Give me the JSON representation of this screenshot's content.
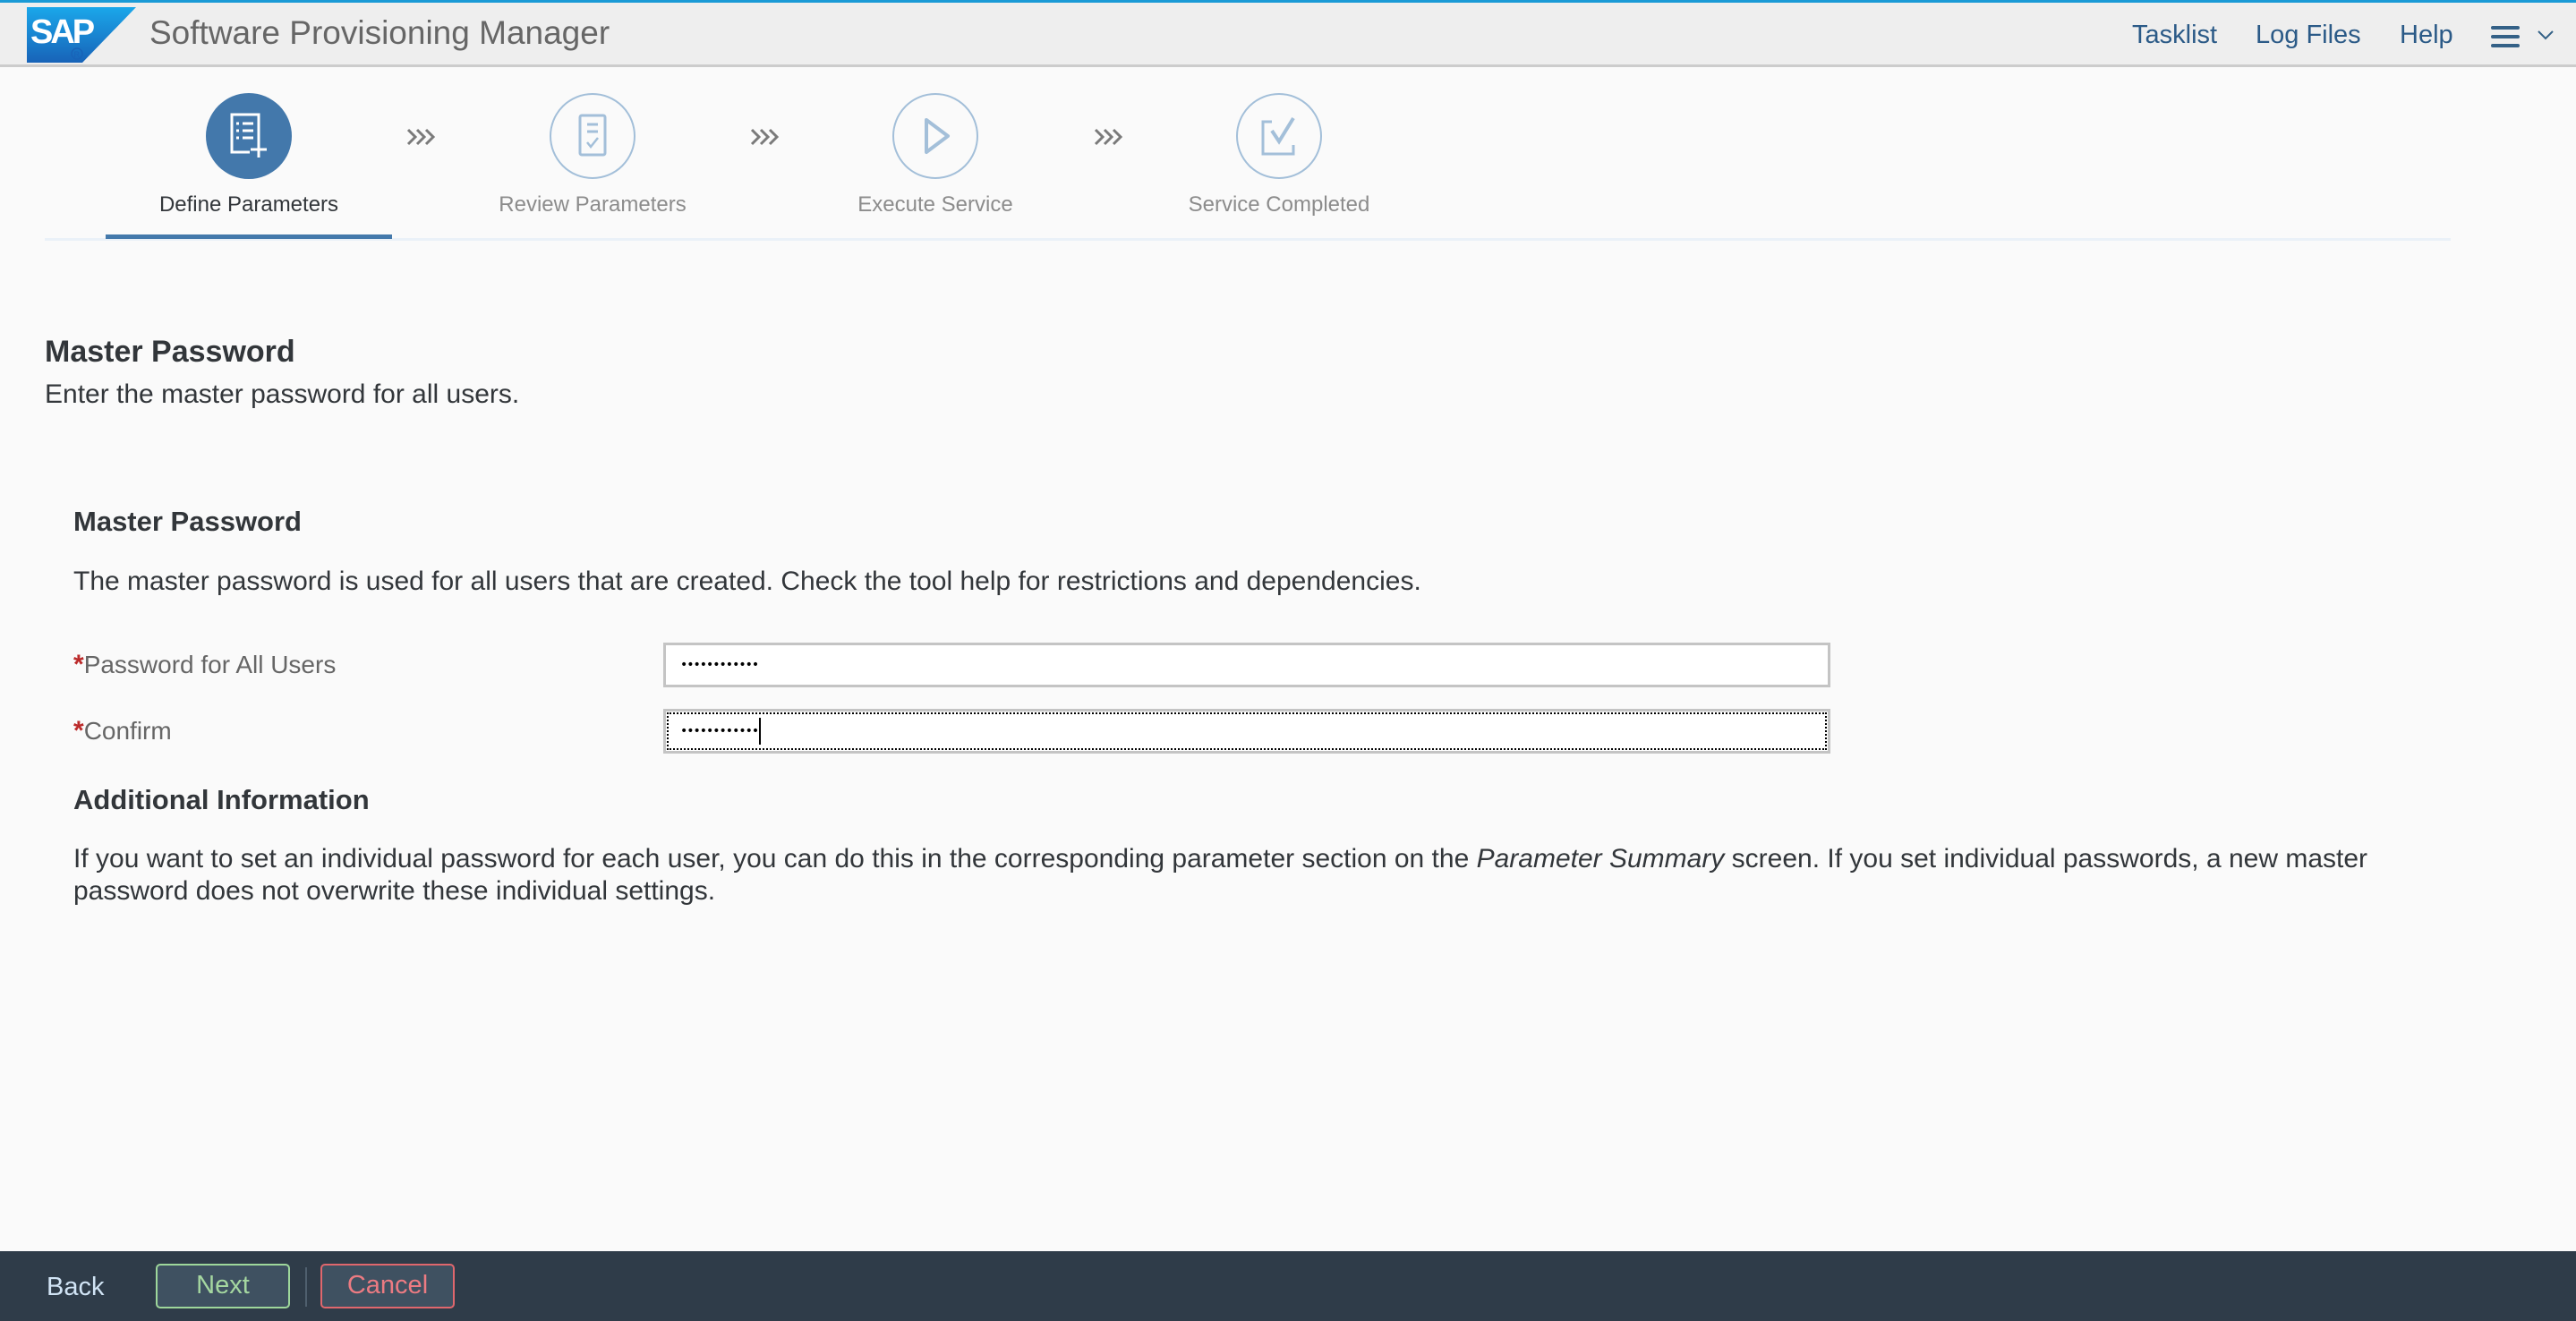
{
  "header": {
    "logo_text": "SAP",
    "title": "Software Provisioning Manager",
    "nav": [
      "Tasklist",
      "Log Files",
      "Help"
    ],
    "menu_icon": "hamburger-menu-icon",
    "colors": {
      "top_accent": "#1a9ad6",
      "nav_link": "#2b5a87"
    }
  },
  "steps": [
    {
      "label": "Define Parameters",
      "icon": "form-add-icon",
      "state": "active"
    },
    {
      "label": "Review Parameters",
      "icon": "review-document-icon",
      "state": "inactive"
    },
    {
      "label": "Execute Service",
      "icon": "play-icon",
      "state": "inactive"
    },
    {
      "label": "Service Completed",
      "icon": "checkbox-complete-icon",
      "state": "inactive"
    }
  ],
  "page": {
    "title": "Master Password",
    "subtitle": "Enter the master password for all users."
  },
  "section": {
    "heading": "Master Password",
    "description": "The master password is used for all users that are created. Check the tool help for restrictions and dependencies.",
    "fields": [
      {
        "label": "Password for All Users",
        "required": true,
        "value": "••••••••••••",
        "focused": false
      },
      {
        "label": "Confirm",
        "required": true,
        "value": "••••••••••••",
        "focused": true
      }
    ],
    "required_marker": "*"
  },
  "additional": {
    "heading": "Additional Information",
    "text_before": "If you want to set an individual password for each user, you can do this in the corresponding parameter section on the ",
    "text_italic": "Parameter Summary",
    "text_after": " screen. If you set individual passwords, a new master password does not overwrite these individual settings."
  },
  "footer": {
    "back_label": "Back",
    "next_label": "Next",
    "cancel_label": "Cancel",
    "colors": {
      "bar": "#2f3c49",
      "next": "#a5d7a0",
      "cancel": "#ec7b82"
    }
  }
}
